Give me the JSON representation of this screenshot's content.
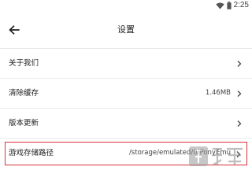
{
  "status_bar": {
    "time": "2:25",
    "icons": [
      "wifi-icon",
      "battery-icon"
    ]
  },
  "app_bar": {
    "title": "设置",
    "back_icon": "arrow-left-icon"
  },
  "settings": {
    "items": [
      {
        "label": "关于我们",
        "value": "",
        "icon": "chevron-right-icon"
      },
      {
        "label": "清除缓存",
        "value": "1.46MB",
        "icon": "chevron-right-icon"
      },
      {
        "label": "版本更新",
        "value": "",
        "icon": "chevron-right-icon"
      },
      {
        "label": "游戏存储路径",
        "value": "/storage/emulated/0/PonyEmu",
        "icon": "chevron-right-icon"
      }
    ]
  },
  "colors": {
    "highlight_border": "#d9333a",
    "divider": "#ececec",
    "text": "#222222"
  },
  "watermark": {
    "icon": "watermark-logo-icon"
  }
}
